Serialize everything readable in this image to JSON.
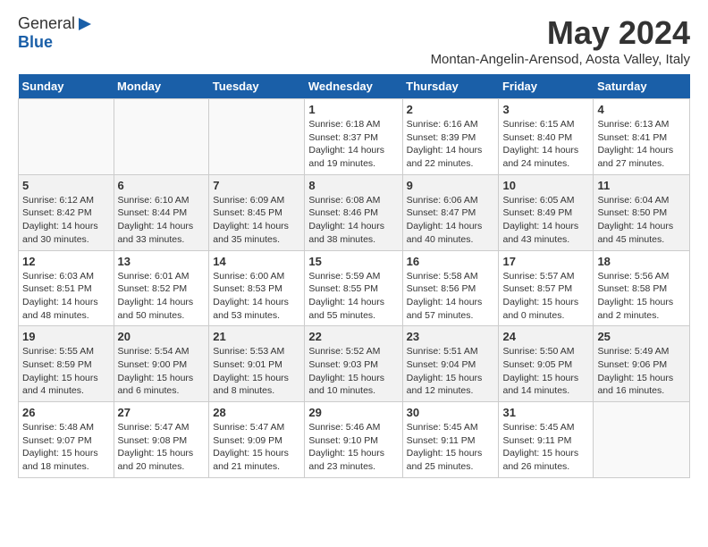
{
  "logo": {
    "general": "General",
    "blue": "Blue"
  },
  "title": "May 2024",
  "subtitle": "Montan-Angelin-Arensod, Aosta Valley, Italy",
  "days_header": [
    "Sunday",
    "Monday",
    "Tuesday",
    "Wednesday",
    "Thursday",
    "Friday",
    "Saturday"
  ],
  "weeks": [
    [
      {
        "num": "",
        "info": ""
      },
      {
        "num": "",
        "info": ""
      },
      {
        "num": "",
        "info": ""
      },
      {
        "num": "1",
        "info": "Sunrise: 6:18 AM\nSunset: 8:37 PM\nDaylight: 14 hours\nand 19 minutes."
      },
      {
        "num": "2",
        "info": "Sunrise: 6:16 AM\nSunset: 8:39 PM\nDaylight: 14 hours\nand 22 minutes."
      },
      {
        "num": "3",
        "info": "Sunrise: 6:15 AM\nSunset: 8:40 PM\nDaylight: 14 hours\nand 24 minutes."
      },
      {
        "num": "4",
        "info": "Sunrise: 6:13 AM\nSunset: 8:41 PM\nDaylight: 14 hours\nand 27 minutes."
      }
    ],
    [
      {
        "num": "5",
        "info": "Sunrise: 6:12 AM\nSunset: 8:42 PM\nDaylight: 14 hours\nand 30 minutes."
      },
      {
        "num": "6",
        "info": "Sunrise: 6:10 AM\nSunset: 8:44 PM\nDaylight: 14 hours\nand 33 minutes."
      },
      {
        "num": "7",
        "info": "Sunrise: 6:09 AM\nSunset: 8:45 PM\nDaylight: 14 hours\nand 35 minutes."
      },
      {
        "num": "8",
        "info": "Sunrise: 6:08 AM\nSunset: 8:46 PM\nDaylight: 14 hours\nand 38 minutes."
      },
      {
        "num": "9",
        "info": "Sunrise: 6:06 AM\nSunset: 8:47 PM\nDaylight: 14 hours\nand 40 minutes."
      },
      {
        "num": "10",
        "info": "Sunrise: 6:05 AM\nSunset: 8:49 PM\nDaylight: 14 hours\nand 43 minutes."
      },
      {
        "num": "11",
        "info": "Sunrise: 6:04 AM\nSunset: 8:50 PM\nDaylight: 14 hours\nand 45 minutes."
      }
    ],
    [
      {
        "num": "12",
        "info": "Sunrise: 6:03 AM\nSunset: 8:51 PM\nDaylight: 14 hours\nand 48 minutes."
      },
      {
        "num": "13",
        "info": "Sunrise: 6:01 AM\nSunset: 8:52 PM\nDaylight: 14 hours\nand 50 minutes."
      },
      {
        "num": "14",
        "info": "Sunrise: 6:00 AM\nSunset: 8:53 PM\nDaylight: 14 hours\nand 53 minutes."
      },
      {
        "num": "15",
        "info": "Sunrise: 5:59 AM\nSunset: 8:55 PM\nDaylight: 14 hours\nand 55 minutes."
      },
      {
        "num": "16",
        "info": "Sunrise: 5:58 AM\nSunset: 8:56 PM\nDaylight: 14 hours\nand 57 minutes."
      },
      {
        "num": "17",
        "info": "Sunrise: 5:57 AM\nSunset: 8:57 PM\nDaylight: 15 hours\nand 0 minutes."
      },
      {
        "num": "18",
        "info": "Sunrise: 5:56 AM\nSunset: 8:58 PM\nDaylight: 15 hours\nand 2 minutes."
      }
    ],
    [
      {
        "num": "19",
        "info": "Sunrise: 5:55 AM\nSunset: 8:59 PM\nDaylight: 15 hours\nand 4 minutes."
      },
      {
        "num": "20",
        "info": "Sunrise: 5:54 AM\nSunset: 9:00 PM\nDaylight: 15 hours\nand 6 minutes."
      },
      {
        "num": "21",
        "info": "Sunrise: 5:53 AM\nSunset: 9:01 PM\nDaylight: 15 hours\nand 8 minutes."
      },
      {
        "num": "22",
        "info": "Sunrise: 5:52 AM\nSunset: 9:03 PM\nDaylight: 15 hours\nand 10 minutes."
      },
      {
        "num": "23",
        "info": "Sunrise: 5:51 AM\nSunset: 9:04 PM\nDaylight: 15 hours\nand 12 minutes."
      },
      {
        "num": "24",
        "info": "Sunrise: 5:50 AM\nSunset: 9:05 PM\nDaylight: 15 hours\nand 14 minutes."
      },
      {
        "num": "25",
        "info": "Sunrise: 5:49 AM\nSunset: 9:06 PM\nDaylight: 15 hours\nand 16 minutes."
      }
    ],
    [
      {
        "num": "26",
        "info": "Sunrise: 5:48 AM\nSunset: 9:07 PM\nDaylight: 15 hours\nand 18 minutes."
      },
      {
        "num": "27",
        "info": "Sunrise: 5:47 AM\nSunset: 9:08 PM\nDaylight: 15 hours\nand 20 minutes."
      },
      {
        "num": "28",
        "info": "Sunrise: 5:47 AM\nSunset: 9:09 PM\nDaylight: 15 hours\nand 21 minutes."
      },
      {
        "num": "29",
        "info": "Sunrise: 5:46 AM\nSunset: 9:10 PM\nDaylight: 15 hours\nand 23 minutes."
      },
      {
        "num": "30",
        "info": "Sunrise: 5:45 AM\nSunset: 9:11 PM\nDaylight: 15 hours\nand 25 minutes."
      },
      {
        "num": "31",
        "info": "Sunrise: 5:45 AM\nSunset: 9:11 PM\nDaylight: 15 hours\nand 26 minutes."
      },
      {
        "num": "",
        "info": ""
      }
    ]
  ]
}
